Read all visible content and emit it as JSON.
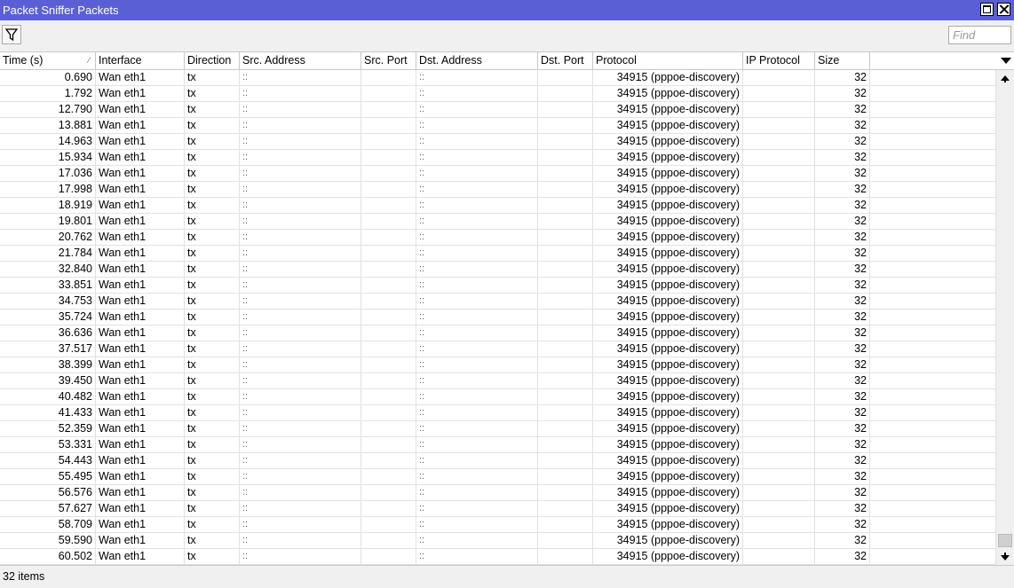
{
  "window": {
    "title": "Packet Sniffer Packets"
  },
  "toolbar": {
    "find_placeholder": "Find"
  },
  "columns": [
    {
      "key": "time",
      "label": "Time (s)"
    },
    {
      "key": "iface",
      "label": "Interface"
    },
    {
      "key": "dir",
      "label": "Direction"
    },
    {
      "key": "src",
      "label": "Src. Address"
    },
    {
      "key": "sport",
      "label": "Src. Port"
    },
    {
      "key": "dst",
      "label": "Dst. Address"
    },
    {
      "key": "dport",
      "label": "Dst. Port"
    },
    {
      "key": "proto",
      "label": "Protocol"
    },
    {
      "key": "ipp",
      "label": "IP Protocol"
    },
    {
      "key": "size",
      "label": "Size"
    }
  ],
  "sort_indicator": "⁄",
  "rows": [
    {
      "time": "0.690",
      "iface": "Wan eth1",
      "dir": "tx",
      "src": "::",
      "dst": "::",
      "proto": "34915 (pppoe-discovery)",
      "size": "32"
    },
    {
      "time": "1.792",
      "iface": "Wan eth1",
      "dir": "tx",
      "src": "::",
      "dst": "::",
      "proto": "34915 (pppoe-discovery)",
      "size": "32"
    },
    {
      "time": "12.790",
      "iface": "Wan eth1",
      "dir": "tx",
      "src": "::",
      "dst": "::",
      "proto": "34915 (pppoe-discovery)",
      "size": "32"
    },
    {
      "time": "13.881",
      "iface": "Wan eth1",
      "dir": "tx",
      "src": "::",
      "dst": "::",
      "proto": "34915 (pppoe-discovery)",
      "size": "32"
    },
    {
      "time": "14.963",
      "iface": "Wan eth1",
      "dir": "tx",
      "src": "::",
      "dst": "::",
      "proto": "34915 (pppoe-discovery)",
      "size": "32"
    },
    {
      "time": "15.934",
      "iface": "Wan eth1",
      "dir": "tx",
      "src": "::",
      "dst": "::",
      "proto": "34915 (pppoe-discovery)",
      "size": "32"
    },
    {
      "time": "17.036",
      "iface": "Wan eth1",
      "dir": "tx",
      "src": "::",
      "dst": "::",
      "proto": "34915 (pppoe-discovery)",
      "size": "32"
    },
    {
      "time": "17.998",
      "iface": "Wan eth1",
      "dir": "tx",
      "src": "::",
      "dst": "::",
      "proto": "34915 (pppoe-discovery)",
      "size": "32"
    },
    {
      "time": "18.919",
      "iface": "Wan eth1",
      "dir": "tx",
      "src": "::",
      "dst": "::",
      "proto": "34915 (pppoe-discovery)",
      "size": "32"
    },
    {
      "time": "19.801",
      "iface": "Wan eth1",
      "dir": "tx",
      "src": "::",
      "dst": "::",
      "proto": "34915 (pppoe-discovery)",
      "size": "32"
    },
    {
      "time": "20.762",
      "iface": "Wan eth1",
      "dir": "tx",
      "src": "::",
      "dst": "::",
      "proto": "34915 (pppoe-discovery)",
      "size": "32"
    },
    {
      "time": "21.784",
      "iface": "Wan eth1",
      "dir": "tx",
      "src": "::",
      "dst": "::",
      "proto": "34915 (pppoe-discovery)",
      "size": "32"
    },
    {
      "time": "32.840",
      "iface": "Wan eth1",
      "dir": "tx",
      "src": "::",
      "dst": "::",
      "proto": "34915 (pppoe-discovery)",
      "size": "32"
    },
    {
      "time": "33.851",
      "iface": "Wan eth1",
      "dir": "tx",
      "src": "::",
      "dst": "::",
      "proto": "34915 (pppoe-discovery)",
      "size": "32"
    },
    {
      "time": "34.753",
      "iface": "Wan eth1",
      "dir": "tx",
      "src": "::",
      "dst": "::",
      "proto": "34915 (pppoe-discovery)",
      "size": "32"
    },
    {
      "time": "35.724",
      "iface": "Wan eth1",
      "dir": "tx",
      "src": "::",
      "dst": "::",
      "proto": "34915 (pppoe-discovery)",
      "size": "32"
    },
    {
      "time": "36.636",
      "iface": "Wan eth1",
      "dir": "tx",
      "src": "::",
      "dst": "::",
      "proto": "34915 (pppoe-discovery)",
      "size": "32"
    },
    {
      "time": "37.517",
      "iface": "Wan eth1",
      "dir": "tx",
      "src": "::",
      "dst": "::",
      "proto": "34915 (pppoe-discovery)",
      "size": "32"
    },
    {
      "time": "38.399",
      "iface": "Wan eth1",
      "dir": "tx",
      "src": "::",
      "dst": "::",
      "proto": "34915 (pppoe-discovery)",
      "size": "32"
    },
    {
      "time": "39.450",
      "iface": "Wan eth1",
      "dir": "tx",
      "src": "::",
      "dst": "::",
      "proto": "34915 (pppoe-discovery)",
      "size": "32"
    },
    {
      "time": "40.482",
      "iface": "Wan eth1",
      "dir": "tx",
      "src": "::",
      "dst": "::",
      "proto": "34915 (pppoe-discovery)",
      "size": "32"
    },
    {
      "time": "41.433",
      "iface": "Wan eth1",
      "dir": "tx",
      "src": "::",
      "dst": "::",
      "proto": "34915 (pppoe-discovery)",
      "size": "32"
    },
    {
      "time": "52.359",
      "iface": "Wan eth1",
      "dir": "tx",
      "src": "::",
      "dst": "::",
      "proto": "34915 (pppoe-discovery)",
      "size": "32"
    },
    {
      "time": "53.331",
      "iface": "Wan eth1",
      "dir": "tx",
      "src": "::",
      "dst": "::",
      "proto": "34915 (pppoe-discovery)",
      "size": "32"
    },
    {
      "time": "54.443",
      "iface": "Wan eth1",
      "dir": "tx",
      "src": "::",
      "dst": "::",
      "proto": "34915 (pppoe-discovery)",
      "size": "32"
    },
    {
      "time": "55.495",
      "iface": "Wan eth1",
      "dir": "tx",
      "src": "::",
      "dst": "::",
      "proto": "34915 (pppoe-discovery)",
      "size": "32"
    },
    {
      "time": "56.576",
      "iface": "Wan eth1",
      "dir": "tx",
      "src": "::",
      "dst": "::",
      "proto": "34915 (pppoe-discovery)",
      "size": "32"
    },
    {
      "time": "57.627",
      "iface": "Wan eth1",
      "dir": "tx",
      "src": "::",
      "dst": "::",
      "proto": "34915 (pppoe-discovery)",
      "size": "32"
    },
    {
      "time": "58.709",
      "iface": "Wan eth1",
      "dir": "tx",
      "src": "::",
      "dst": "::",
      "proto": "34915 (pppoe-discovery)",
      "size": "32"
    },
    {
      "time": "59.590",
      "iface": "Wan eth1",
      "dir": "tx",
      "src": "::",
      "dst": "::",
      "proto": "34915 (pppoe-discovery)",
      "size": "32"
    },
    {
      "time": "60.502",
      "iface": "Wan eth1",
      "dir": "tx",
      "src": "::",
      "dst": "::",
      "proto": "34915 (pppoe-discovery)",
      "size": "32"
    }
  ],
  "status": {
    "items_label": "32 items"
  },
  "icons": {
    "filter": "filter-icon",
    "maximize": "maximize-icon",
    "close": "close-icon",
    "scroll_up": "arrow-up-icon",
    "scroll_down": "arrow-down-icon",
    "column_menu": "chevron-down-icon"
  },
  "colors": {
    "titlebar": "#5b5fd6"
  }
}
